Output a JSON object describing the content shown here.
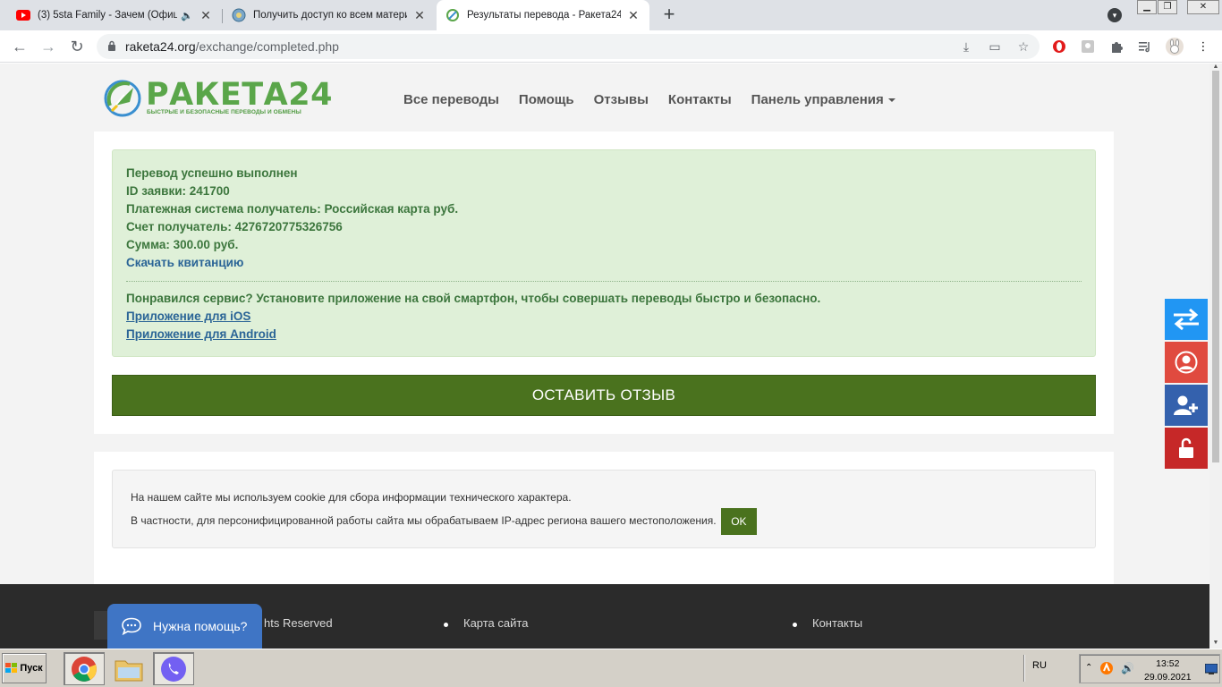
{
  "browser": {
    "tabs": [
      {
        "title": "(3) 5sta Family - Зачем (Офици",
        "icon": "youtube-icon",
        "audio": true
      },
      {
        "title": "Получить доступ ко всем материа",
        "icon": "site-globe-icon"
      },
      {
        "title": "Результаты перевода - Ракета24",
        "icon": "raketa-icon",
        "active": true
      }
    ],
    "url_host": "raketa24.org",
    "url_path": "/exchange/completed.php"
  },
  "site": {
    "logo_word": "РАКЕТА24",
    "logo_tagline": "БЫСТРЫЕ И БЕЗОПАСНЫЕ ПЕРЕВОДЫ И ОБМЕНЫ",
    "nav": [
      "Все переводы",
      "Помощь",
      "Отзывы",
      "Контакты",
      "Панель управления"
    ]
  },
  "result": {
    "line1": "Перевод успешно выполнен",
    "line2": "ID заявки: 241700",
    "line3": "Платежная система получатель: Российская карта руб.",
    "line4": "Счет получатель: 4276720775326756",
    "line5": "Сумма: 300.00 руб.",
    "receipt_link": "Скачать квитанцию",
    "app_promo": "Понравился сервис? Установите приложение на свой смартфон, чтобы совершать переводы быстро и безопасно.",
    "ios_link": "Приложение для iOS",
    "android_link": "Приложение для Android",
    "review_button": "ОСТАВИТЬ ОТЗЫВ"
  },
  "cookie": {
    "line1": "На нашем сайте мы используем cookie для сбора информации технического характера.",
    "line2": "В частности, для персонифицированной работы сайта мы обрабатываем IP-адрес региона вашего местоположения.",
    "ok": "OK"
  },
  "footer": {
    "rights": "hts Reserved",
    "col1_item": "Карта сайта",
    "col2_item": "Контакты"
  },
  "help_widget": "Нужна помощь?",
  "taskbar": {
    "start": "Пуск",
    "lang": "RU",
    "time": "13:52",
    "date": "29.09.2021"
  },
  "colors": {
    "brand_green": "#5aa64a",
    "button_green": "#4a721e",
    "success_bg": "#dff0d8",
    "side_blue": "#2196f3",
    "side_red": "#e04a3f",
    "side_navy": "#3461ad",
    "side_darkred": "#c62828"
  }
}
